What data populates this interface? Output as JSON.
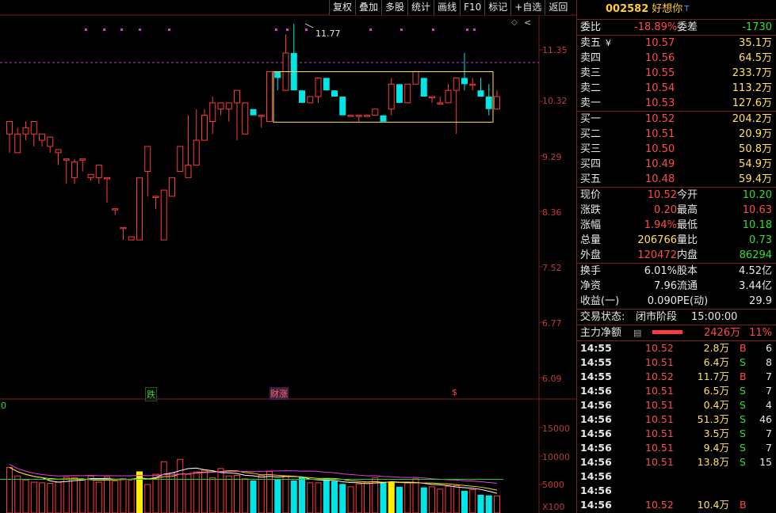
{
  "toolbar": {
    "items": [
      "复权",
      "叠加",
      "多股",
      "统计",
      "画线",
      "F10",
      "标记",
      "+自选",
      "返回"
    ]
  },
  "chart": {
    "price_axis": [
      "11.35",
      "10.32",
      "9.29",
      "8.36",
      "7.52",
      "6.77",
      "6.09"
    ],
    "volume_axis": [
      "15000",
      "10000",
      "5000",
      "X100"
    ],
    "high_marker": "11.77",
    "event_markers": [
      "跌",
      "财涨",
      "$"
    ],
    "volume_panel_label": "0",
    "candles": [
      [
        10.0,
        10.2,
        9.7,
        9.7
      ],
      [
        9.7,
        10.0,
        9.7,
        10.1
      ],
      [
        10.0,
        10.1,
        9.9,
        10.2
      ],
      [
        10.0,
        10.2,
        9.8,
        9.9
      ],
      [
        9.9,
        10.0,
        9.8,
        9.85
      ],
      [
        9.8,
        9.95,
        9.7,
        9.7
      ],
      [
        9.7,
        9.75,
        9.5,
        9.6
      ],
      [
        9.6,
        9.6,
        9.2,
        9.3
      ],
      [
        9.3,
        9.55,
        9.2,
        9.6
      ],
      [
        9.6,
        9.6,
        9.4,
        9.3
      ],
      [
        9.3,
        9.35,
        9.25,
        9.3
      ],
      [
        9.3,
        9.5,
        9.2,
        9.3
      ],
      [
        9.3,
        9.3,
        8.9,
        8.8
      ],
      [
        8.8,
        8.8,
        8.7,
        8.5
      ],
      [
        8.5,
        8.5,
        8.3,
        8.2
      ],
      [
        8.3,
        8.35,
        8.3,
        8.3
      ],
      [
        8.3,
        9.3,
        8.3,
        9.3
      ],
      [
        9.4,
        9.8,
        9.0,
        9.6
      ],
      [
        9.0,
        9.0,
        8.8,
        8.7
      ],
      [
        8.3,
        9.1,
        8.3,
        9.1
      ],
      [
        9.0,
        9.3,
        9.0,
        9.3
      ],
      [
        9.4,
        9.8,
        9.4,
        9.8
      ],
      [
        9.3,
        9.5,
        9.3,
        10.3
      ],
      [
        9.5,
        9.9,
        9.6,
        10.4
      ],
      [
        9.9,
        10.3,
        10.0,
        10.4
      ],
      [
        10.2,
        10.5,
        10.0,
        10.6
      ],
      [
        10.4,
        10.5,
        10.3,
        10.3
      ],
      [
        10.4,
        10.5,
        10.2,
        10.1
      ],
      [
        10.5,
        10.7,
        9.9,
        9.8
      ],
      [
        10.0,
        10.5,
        10.3,
        10.3
      ],
      [
        10.4,
        10.3,
        10.3,
        10.3
      ],
      [
        10.3,
        10.3,
        10.1,
        10.1
      ],
      [
        10.2,
        11.0,
        10.3,
        11.0
      ],
      [
        11.0,
        10.9,
        10.7,
        10.4
      ],
      [
        10.7,
        11.3,
        10.8,
        11.6
      ],
      [
        11.3,
        10.7,
        10.7,
        11.77
      ],
      [
        10.7,
        10.5,
        10.5,
        10.5
      ],
      [
        10.5,
        10.6,
        10.5,
        10.5
      ],
      [
        10.6,
        10.9,
        10.5,
        10.9
      ],
      [
        10.9,
        10.7,
        10.7,
        10.9
      ],
      [
        10.7,
        10.6,
        10.6,
        10.6
      ],
      [
        10.6,
        10.3,
        10.3,
        10.3
      ],
      [
        10.3,
        10.3,
        10.3,
        10.3
      ],
      [
        10.3,
        10.3,
        10.2,
        10.3
      ],
      [
        10.3,
        10.3,
        10.3,
        10.3
      ],
      [
        10.3,
        10.4,
        10.3,
        10.3
      ],
      [
        10.3,
        10.2,
        10.2,
        10.2
      ],
      [
        10.4,
        10.8,
        10.3,
        10.9
      ],
      [
        10.8,
        10.5,
        10.5,
        10.5
      ],
      [
        10.5,
        10.8,
        10.5,
        10.8
      ],
      [
        10.8,
        11.0,
        10.8,
        10.9
      ],
      [
        10.9,
        10.6,
        10.6,
        10.6
      ],
      [
        10.6,
        10.6,
        10.5,
        10.6
      ],
      [
        10.5,
        10.5,
        10.5,
        10.6
      ],
      [
        10.5,
        10.7,
        10.5,
        10.8
      ],
      [
        10.7,
        10.9,
        10.0,
        10.8
      ],
      [
        10.9,
        10.8,
        10.7,
        11.3
      ],
      [
        10.8,
        10.8,
        10.7,
        10.9
      ],
      [
        10.7,
        10.6,
        10.6,
        10.9
      ],
      [
        10.6,
        10.4,
        10.3,
        10.8
      ],
      [
        10.4,
        10.6,
        10.4,
        10.7
      ]
    ],
    "volumes": [
      8000,
      6500,
      5800,
      5400,
      5300,
      5200,
      5400,
      6300,
      6200,
      5800,
      6500,
      5400,
      6300,
      5600,
      6000,
      5900,
      7300,
      5000,
      6800,
      9000,
      7000,
      9400,
      6800,
      7200,
      7500,
      6200,
      7800,
      6500,
      6600,
      6000,
      5700,
      6600,
      7300,
      5900,
      6500,
      5700,
      6300,
      5300,
      5300,
      6100,
      5600,
      5100,
      4600,
      5100,
      5400,
      6200,
      5300,
      5500,
      4600,
      5400,
      6000,
      4500,
      4600,
      4200,
      4700,
      4800,
      3900,
      4100,
      3200,
      3100,
      3000
    ]
  },
  "quote": {
    "code": "002582",
    "name": "好想你",
    "tag": "T",
    "weibi_label": "委比",
    "weibi": "-18.89%",
    "weicha_label": "委差",
    "weicha": "-1730",
    "sell": [
      {
        "label": "卖五",
        "mark": "¥",
        "price": "10.57",
        "vol": "35.1万"
      },
      {
        "label": "卖四",
        "mark": "",
        "price": "10.56",
        "vol": "64.5万"
      },
      {
        "label": "卖三",
        "mark": "",
        "price": "10.55",
        "vol": "233.7万"
      },
      {
        "label": "卖二",
        "mark": "",
        "price": "10.54",
        "vol": "113.2万"
      },
      {
        "label": "卖一",
        "mark": "",
        "price": "10.53",
        "vol": "127.6万"
      }
    ],
    "buy": [
      {
        "label": "买一",
        "price": "10.52",
        "vol": "204.2万"
      },
      {
        "label": "买二",
        "price": "10.51",
        "vol": "20.9万"
      },
      {
        "label": "买三",
        "price": "10.50",
        "vol": "50.8万"
      },
      {
        "label": "买四",
        "price": "10.49",
        "vol": "54.9万"
      },
      {
        "label": "买五",
        "price": "10.48",
        "vol": "59.4万"
      }
    ],
    "stats": [
      {
        "l1": "现价",
        "v1": "10.52",
        "c1": "red",
        "l2": "今开",
        "v2": "10.20",
        "c2": "grn"
      },
      {
        "l1": "涨跌",
        "v1": "0.20",
        "c1": "red",
        "l2": "最高",
        "v2": "10.63",
        "c2": "red"
      },
      {
        "l1": "涨幅",
        "v1": "1.94%",
        "c1": "red",
        "l2": "最低",
        "v2": "10.18",
        "c2": "grn"
      },
      {
        "l1": "总量",
        "v1": "206766",
        "c1": "yel",
        "l2": "量比",
        "v2": "0.73",
        "c2": "grn"
      },
      {
        "l1": "外盘",
        "v1": "120472",
        "c1": "red",
        "l2": "内盘",
        "v2": "86294",
        "c2": "grn"
      }
    ],
    "finance": [
      {
        "l1": "换手",
        "v1": "6.01%",
        "l2": "股本",
        "v2": "4.52亿"
      },
      {
        "l1": "净资",
        "v1": "7.96",
        "l2": "流通",
        "v2": "3.44亿"
      },
      {
        "l1": "收益(一)",
        "v1": "0.090",
        "l2": "PE(动)",
        "v2": "29.9"
      }
    ],
    "trade_state_label": "交易状态:",
    "trade_state": "闭市阶段",
    "trade_time": "15:00:00",
    "main_flow_label": "主力净额",
    "main_flow_value": "2426万",
    "main_flow_pct": "11%",
    "ticks": [
      {
        "t": "14:55",
        "p": "10.52",
        "v": "2.8万",
        "s": "B",
        "n": "6"
      },
      {
        "t": "14:55",
        "p": "10.51",
        "v": "6.4万",
        "s": "S",
        "n": "8"
      },
      {
        "t": "14:55",
        "p": "10.52",
        "v": "11.7万",
        "s": "B",
        "n": "7"
      },
      {
        "t": "14:56",
        "p": "10.51",
        "v": "6.5万",
        "s": "S",
        "n": "7"
      },
      {
        "t": "14:56",
        "p": "10.51",
        "v": "0.4万",
        "s": "S",
        "n": "4"
      },
      {
        "t": "14:56",
        "p": "10.51",
        "v": "51.3万",
        "s": "S",
        "n": "46"
      },
      {
        "t": "14:56",
        "p": "10.51",
        "v": "3.5万",
        "s": "S",
        "n": "7"
      },
      {
        "t": "14:56",
        "p": "10.51",
        "v": "9.4万",
        "s": "S",
        "n": "7"
      },
      {
        "t": "14:56",
        "p": "10.51",
        "v": "13.8万",
        "s": "S",
        "n": "15"
      },
      {
        "t": "14:56",
        "p": "",
        "v": "",
        "s": "",
        "n": ""
      },
      {
        "t": "14:56",
        "p": "",
        "v": "",
        "s": "",
        "n": ""
      },
      {
        "t": "14:56",
        "p": "10.52",
        "v": "10.4万",
        "s": "B",
        "n": ""
      }
    ]
  }
}
